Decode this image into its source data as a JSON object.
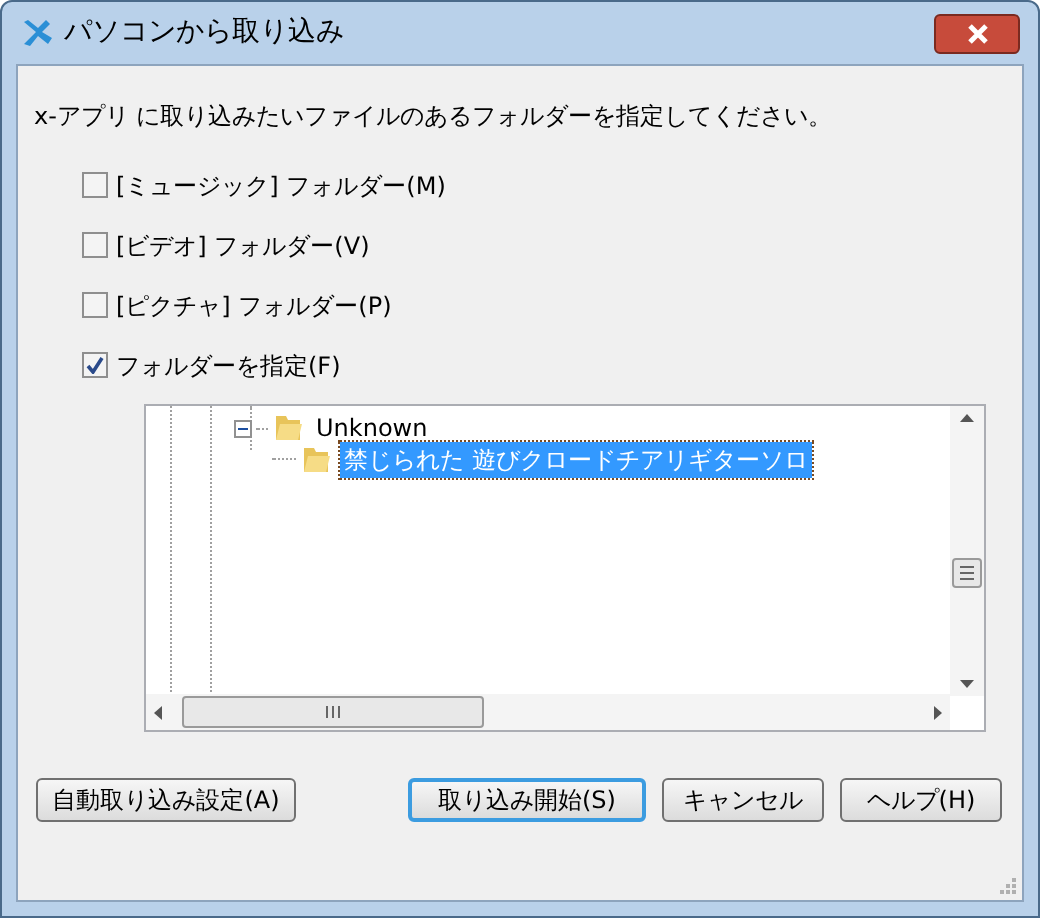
{
  "window": {
    "title": "パソコンから取り込み"
  },
  "instruction": "x-アプリ に取り込みたいファイルのあるフォルダーを指定してください。",
  "options": [
    {
      "label": "[ミュージック] フォルダー(M)",
      "checked": false
    },
    {
      "label": "[ビデオ] フォルダー(V)",
      "checked": false
    },
    {
      "label": "[ピクチャ] フォルダー(P)",
      "checked": false
    },
    {
      "label": "フォルダーを指定(F)",
      "checked": true
    }
  ],
  "folder_tree": {
    "nodes": [
      {
        "label": "Unknown",
        "expanded": true,
        "selected": false,
        "children": [
          {
            "label": "禁じられた 遊びクロードチアリギターソロ",
            "selected": true
          }
        ]
      }
    ]
  },
  "left_buttons": [
    {
      "label": "自動取り込み設定(A)",
      "default": false
    }
  ],
  "right_buttons": [
    {
      "label": "取り込み開始(S)",
      "default": true
    },
    {
      "label": "キャンセル",
      "default": false
    },
    {
      "label": "ヘルプ(H)",
      "default": false
    }
  ]
}
